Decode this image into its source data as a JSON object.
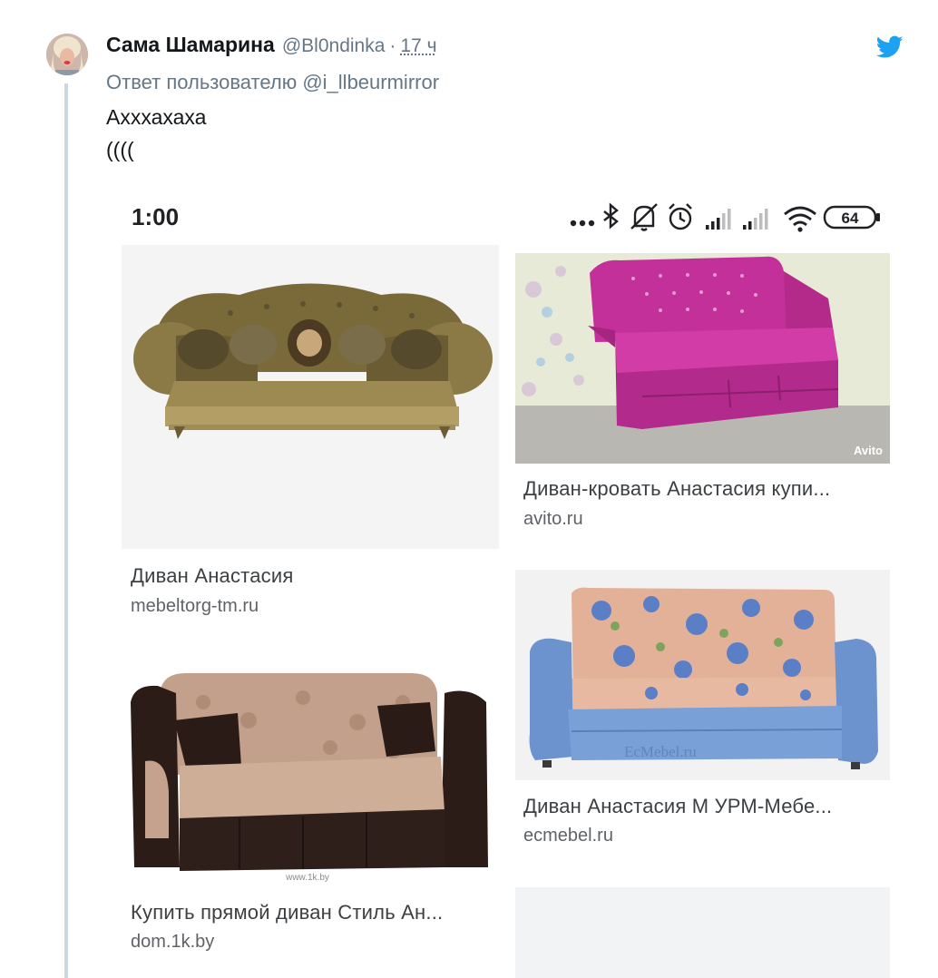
{
  "tweet": {
    "author_name": "Сама Шамарина",
    "author_handle": "@Bl0ndinka",
    "separator": "·",
    "time": "17 ч",
    "reply_to": "Ответ пользователю @i_llbeurmirror",
    "text_lines": [
      "Ахххахаха",
      "(((("
    ]
  },
  "screenshot": {
    "status_bar": {
      "time": "1:00",
      "battery": "64",
      "icons": [
        "more-dots-icon",
        "bluetooth-icon",
        "bell-off-icon",
        "alarm-icon",
        "signal-icon",
        "signal-icon",
        "wifi-icon",
        "battery-icon"
      ]
    },
    "results": [
      {
        "title": "Диван Анастасия",
        "source": "mebeltorg-tm.ru"
      },
      {
        "title": "Диван-кровать Анастасия купи...",
        "source": "avito.ru",
        "watermark": "Avito"
      },
      {
        "title": "Купить прямой диван Стиль Ан...",
        "source": "dom.1k.by",
        "watermark": "www.1k.by"
      },
      {
        "title": "Диван Анастасия М УРМ-Мебе...",
        "source": "ecmebel.ru",
        "watermark": "EcMebel.ru"
      }
    ]
  },
  "colors": {
    "twitter_blue": "#1da1f2",
    "muted": "#657786",
    "card_bg": "#f1f3f4",
    "thread_line": "#ccd6dd"
  }
}
